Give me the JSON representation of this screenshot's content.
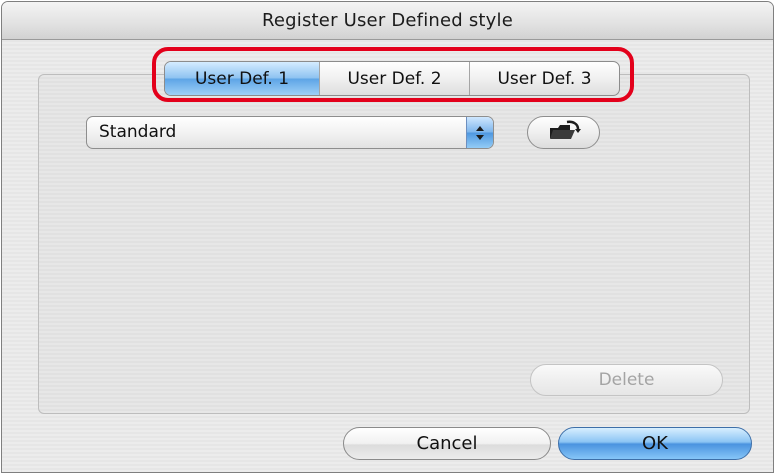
{
  "dialog": {
    "title": "Register User Defined style"
  },
  "tabs": [
    {
      "label": "User Def. 1",
      "selected": true
    },
    {
      "label": "User Def. 2",
      "selected": false
    },
    {
      "label": "User Def. 3",
      "selected": false
    }
  ],
  "style_select": {
    "value": "Standard",
    "icon": "up-down-arrows-icon"
  },
  "open_button": {
    "icon": "open-folder-icon"
  },
  "buttons": {
    "delete": "Delete",
    "delete_enabled": false,
    "cancel": "Cancel",
    "ok": "OK"
  },
  "colors": {
    "highlight": "#e3001b",
    "accent_blue": "#5ea5e6"
  }
}
